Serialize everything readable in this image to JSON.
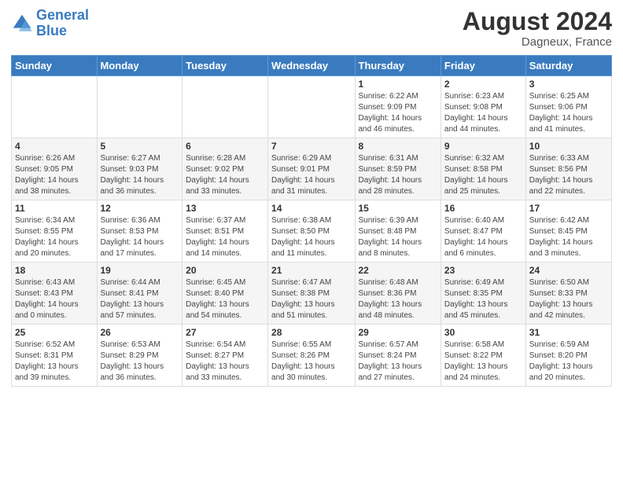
{
  "header": {
    "logo_line1": "General",
    "logo_line2": "Blue",
    "month_year": "August 2024",
    "location": "Dagneux, France"
  },
  "days_of_week": [
    "Sunday",
    "Monday",
    "Tuesday",
    "Wednesday",
    "Thursday",
    "Friday",
    "Saturday"
  ],
  "weeks": [
    [
      {
        "day": "",
        "info": ""
      },
      {
        "day": "",
        "info": ""
      },
      {
        "day": "",
        "info": ""
      },
      {
        "day": "",
        "info": ""
      },
      {
        "day": "1",
        "info": "Sunrise: 6:22 AM\nSunset: 9:09 PM\nDaylight: 14 hours\nand 46 minutes."
      },
      {
        "day": "2",
        "info": "Sunrise: 6:23 AM\nSunset: 9:08 PM\nDaylight: 14 hours\nand 44 minutes."
      },
      {
        "day": "3",
        "info": "Sunrise: 6:25 AM\nSunset: 9:06 PM\nDaylight: 14 hours\nand 41 minutes."
      }
    ],
    [
      {
        "day": "4",
        "info": "Sunrise: 6:26 AM\nSunset: 9:05 PM\nDaylight: 14 hours\nand 38 minutes."
      },
      {
        "day": "5",
        "info": "Sunrise: 6:27 AM\nSunset: 9:03 PM\nDaylight: 14 hours\nand 36 minutes."
      },
      {
        "day": "6",
        "info": "Sunrise: 6:28 AM\nSunset: 9:02 PM\nDaylight: 14 hours\nand 33 minutes."
      },
      {
        "day": "7",
        "info": "Sunrise: 6:29 AM\nSunset: 9:01 PM\nDaylight: 14 hours\nand 31 minutes."
      },
      {
        "day": "8",
        "info": "Sunrise: 6:31 AM\nSunset: 8:59 PM\nDaylight: 14 hours\nand 28 minutes."
      },
      {
        "day": "9",
        "info": "Sunrise: 6:32 AM\nSunset: 8:58 PM\nDaylight: 14 hours\nand 25 minutes."
      },
      {
        "day": "10",
        "info": "Sunrise: 6:33 AM\nSunset: 8:56 PM\nDaylight: 14 hours\nand 22 minutes."
      }
    ],
    [
      {
        "day": "11",
        "info": "Sunrise: 6:34 AM\nSunset: 8:55 PM\nDaylight: 14 hours\nand 20 minutes."
      },
      {
        "day": "12",
        "info": "Sunrise: 6:36 AM\nSunset: 8:53 PM\nDaylight: 14 hours\nand 17 minutes."
      },
      {
        "day": "13",
        "info": "Sunrise: 6:37 AM\nSunset: 8:51 PM\nDaylight: 14 hours\nand 14 minutes."
      },
      {
        "day": "14",
        "info": "Sunrise: 6:38 AM\nSunset: 8:50 PM\nDaylight: 14 hours\nand 11 minutes."
      },
      {
        "day": "15",
        "info": "Sunrise: 6:39 AM\nSunset: 8:48 PM\nDaylight: 14 hours\nand 8 minutes."
      },
      {
        "day": "16",
        "info": "Sunrise: 6:40 AM\nSunset: 8:47 PM\nDaylight: 14 hours\nand 6 minutes."
      },
      {
        "day": "17",
        "info": "Sunrise: 6:42 AM\nSunset: 8:45 PM\nDaylight: 14 hours\nand 3 minutes."
      }
    ],
    [
      {
        "day": "18",
        "info": "Sunrise: 6:43 AM\nSunset: 8:43 PM\nDaylight: 14 hours\nand 0 minutes."
      },
      {
        "day": "19",
        "info": "Sunrise: 6:44 AM\nSunset: 8:41 PM\nDaylight: 13 hours\nand 57 minutes."
      },
      {
        "day": "20",
        "info": "Sunrise: 6:45 AM\nSunset: 8:40 PM\nDaylight: 13 hours\nand 54 minutes."
      },
      {
        "day": "21",
        "info": "Sunrise: 6:47 AM\nSunset: 8:38 PM\nDaylight: 13 hours\nand 51 minutes."
      },
      {
        "day": "22",
        "info": "Sunrise: 6:48 AM\nSunset: 8:36 PM\nDaylight: 13 hours\nand 48 minutes."
      },
      {
        "day": "23",
        "info": "Sunrise: 6:49 AM\nSunset: 8:35 PM\nDaylight: 13 hours\nand 45 minutes."
      },
      {
        "day": "24",
        "info": "Sunrise: 6:50 AM\nSunset: 8:33 PM\nDaylight: 13 hours\nand 42 minutes."
      }
    ],
    [
      {
        "day": "25",
        "info": "Sunrise: 6:52 AM\nSunset: 8:31 PM\nDaylight: 13 hours\nand 39 minutes."
      },
      {
        "day": "26",
        "info": "Sunrise: 6:53 AM\nSunset: 8:29 PM\nDaylight: 13 hours\nand 36 minutes."
      },
      {
        "day": "27",
        "info": "Sunrise: 6:54 AM\nSunset: 8:27 PM\nDaylight: 13 hours\nand 33 minutes."
      },
      {
        "day": "28",
        "info": "Sunrise: 6:55 AM\nSunset: 8:26 PM\nDaylight: 13 hours\nand 30 minutes."
      },
      {
        "day": "29",
        "info": "Sunrise: 6:57 AM\nSunset: 8:24 PM\nDaylight: 13 hours\nand 27 minutes."
      },
      {
        "day": "30",
        "info": "Sunrise: 6:58 AM\nSunset: 8:22 PM\nDaylight: 13 hours\nand 24 minutes."
      },
      {
        "day": "31",
        "info": "Sunrise: 6:59 AM\nSunset: 8:20 PM\nDaylight: 13 hours\nand 20 minutes."
      }
    ]
  ]
}
